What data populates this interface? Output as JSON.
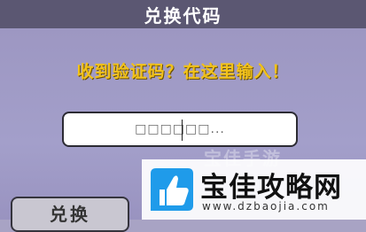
{
  "header": {
    "title": "兑换代码"
  },
  "prompt": {
    "text": "收到验证码？在这里输入！"
  },
  "code_input": {
    "value": "□□□□□□..."
  },
  "redeem_button": {
    "label": "兑换"
  },
  "watermark": {
    "ghost_text": "宝佳手游",
    "brand": "宝佳攻略网",
    "url": "www.dzbaojia.com",
    "logo_icon": "thumbs-up-icon"
  },
  "colors": {
    "title_bar": "#5b5772",
    "panel": "#a39fca",
    "prompt_text": "#f2c21b",
    "logo_blue": "#1f9bea"
  }
}
